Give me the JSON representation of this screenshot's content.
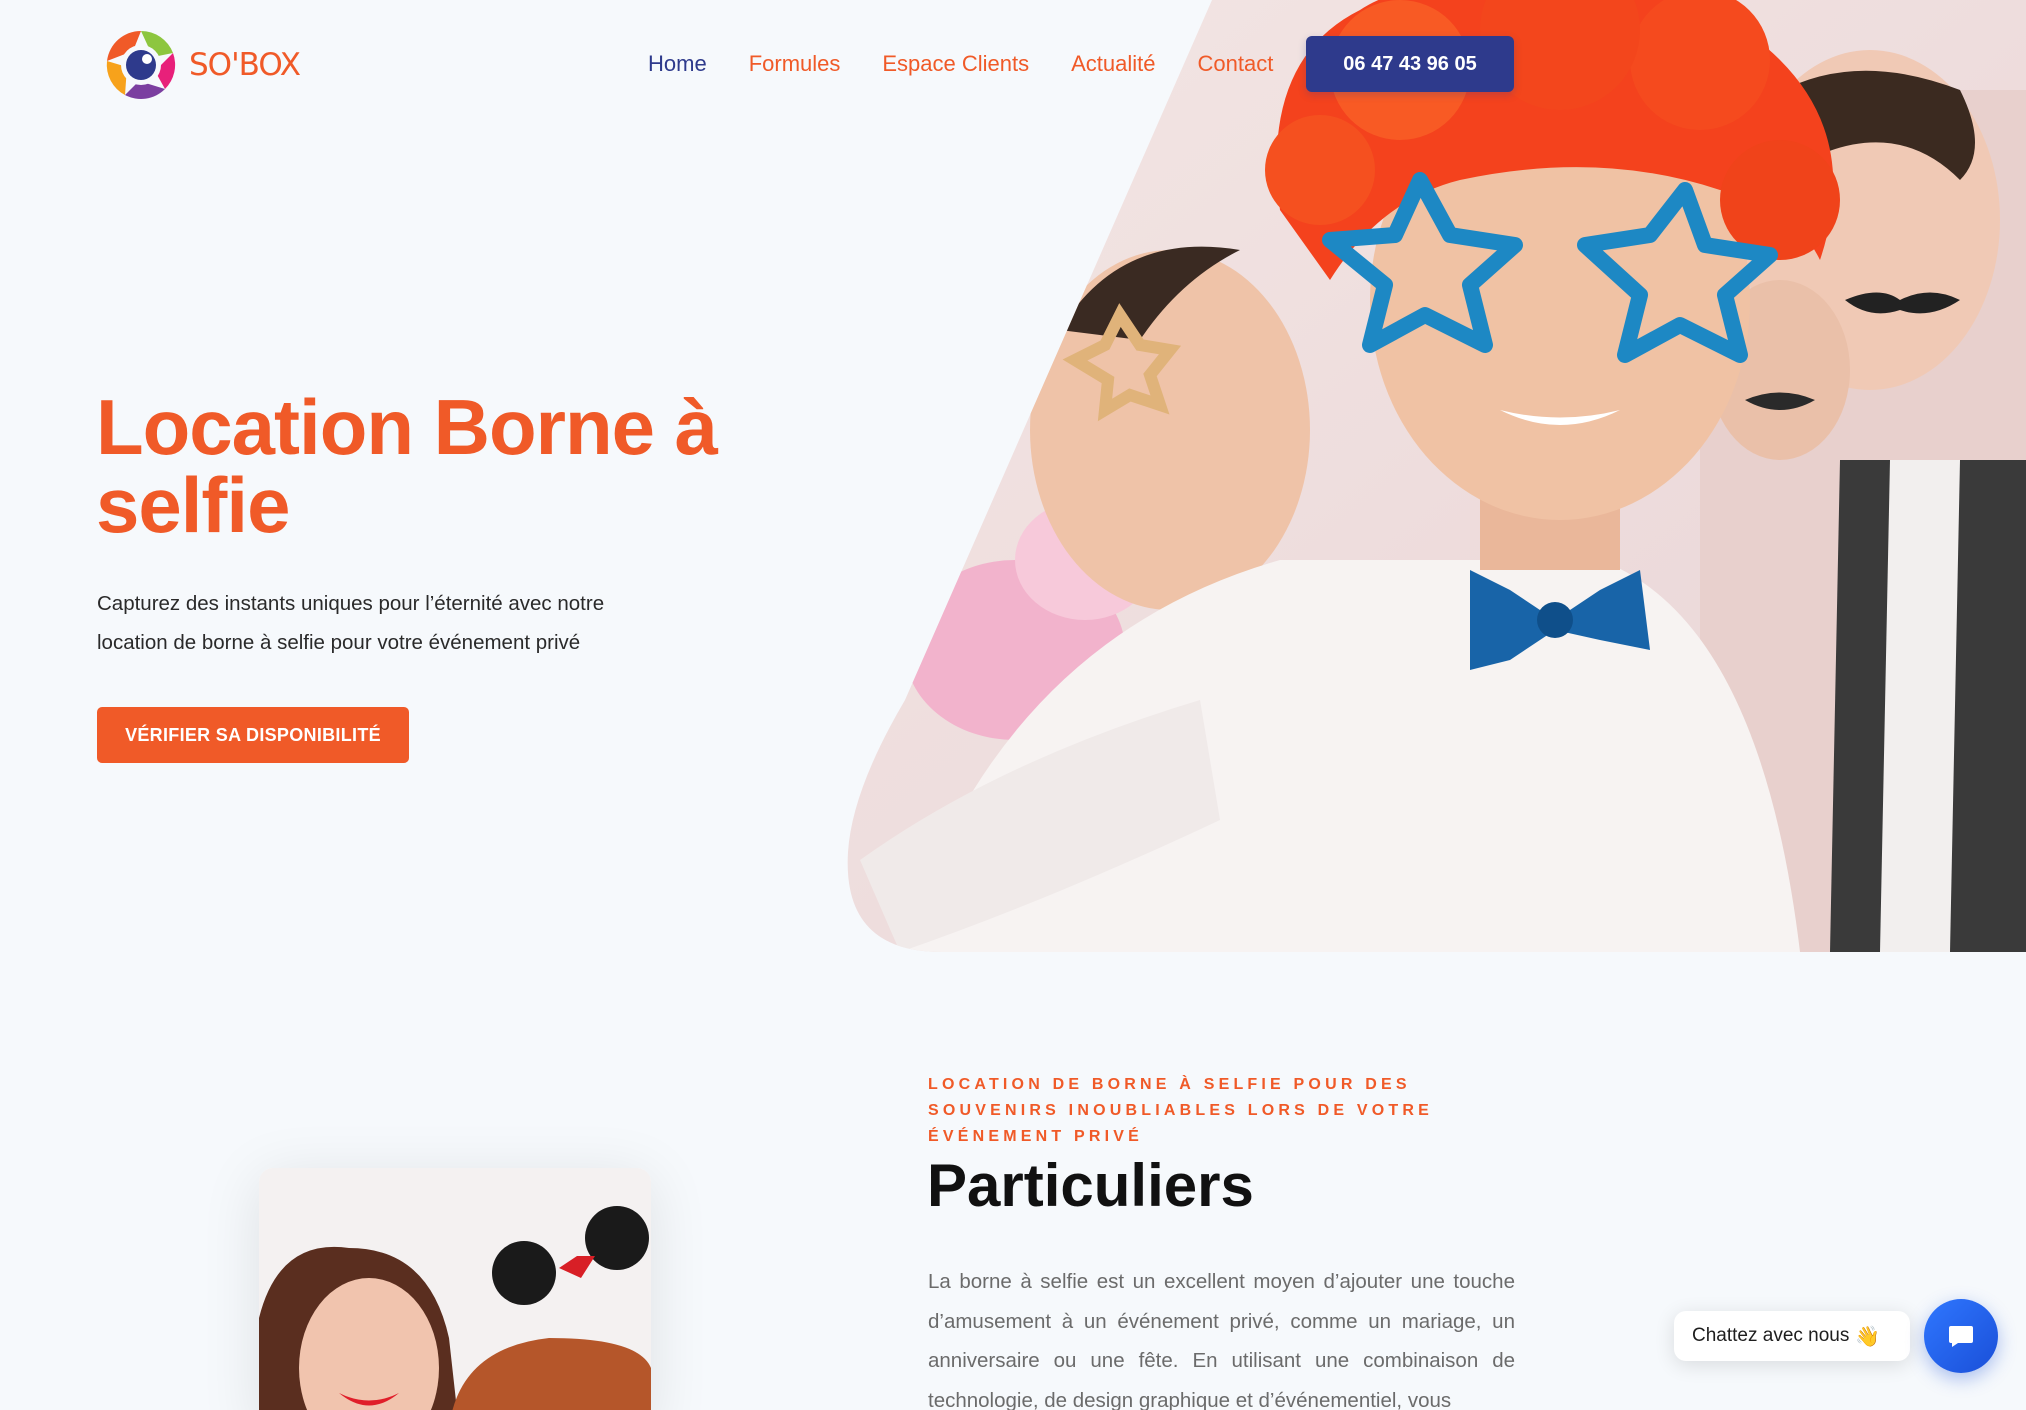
{
  "brand": {
    "name": "SO'BOX"
  },
  "nav": {
    "items": [
      {
        "label": "Home",
        "active": true
      },
      {
        "label": "Formules",
        "active": false
      },
      {
        "label": "Espace Clients",
        "active": false
      },
      {
        "label": "Actualité",
        "active": false
      },
      {
        "label": "Contact",
        "active": false
      }
    ],
    "phone": "06 47 43 96 05"
  },
  "hero": {
    "title": "Location Borne à selfie",
    "text": "Capturez des instants uniques pour l’éternité avec notre location de borne à selfie pour votre événement privé",
    "cta": "VÉRIFIER SA DISPONIBILITÉ"
  },
  "section": {
    "eyebrow": "LOCATION DE BORNE À SELFIE POUR DES SOUVENIRS INOUBLIABLES LORS DE VOTRE ÉVÉNEMENT PRIVÉ",
    "title": "Particuliers",
    "text": "La borne à selfie est un excellent moyen d’ajouter une touche d’amusement à un événement privé, comme un mariage, un anniversaire ou une fête. En utilisant une combinaison de technologie, de design graphique et d’événementiel, vous"
  },
  "chat": {
    "label": "Chattez avec nous",
    "icon": "waving-hand-icon"
  },
  "colors": {
    "accent": "#f05a28",
    "navy": "#2e3a8c",
    "background": "#f6f9fc",
    "chat": "#2f77ff"
  }
}
